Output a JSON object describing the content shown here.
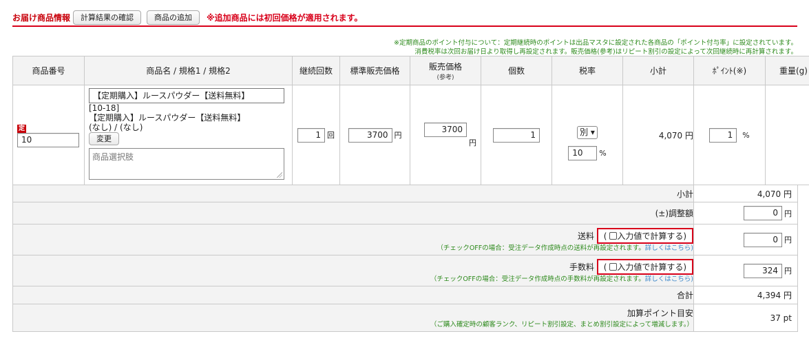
{
  "header": {
    "title": "お届け商品情報",
    "btn_confirm": "計算結果の確認",
    "btn_add": "商品の追加",
    "warning": "※追加商品には初回価格が適用されます。"
  },
  "notes": {
    "line1": "※定期商品のポイント付与について：定期継続時のポイントは出品マスタに設定された各商品の「ポイント付与率」に設定されています。",
    "line2": "消費税率は次回お届け日より取得し再設定されます。販売価格(参考)はリピート割引の設定によって次回継続時に再計算されます。"
  },
  "columns": {
    "code": "商品番号",
    "name": "商品名 / 規格1 / 規格2",
    "count": "継続回数",
    "std_price": "標準販売価格",
    "price": "販売価格",
    "price_sub": "(参考)",
    "qty": "個数",
    "tax": "税率",
    "subtotal": "小計",
    "point": "ﾎﾟｲﾝﾄ(※)",
    "weight": "重量(g)"
  },
  "item": {
    "badge": "定",
    "code": "10",
    "name_input": "【定期購入】ルースパウダー【送料無料】",
    "code_line": "[10-18]",
    "name_line": "【定期購入】ルースパウダー【送料無料】",
    "spec_line": "(なし) / (なし)",
    "change_btn": "変更",
    "option_placeholder": "商品選択肢",
    "count": "1",
    "count_unit": "回",
    "std_price": "3700",
    "yen": "円",
    "price": "3700",
    "qty": "1",
    "tax_select": "別",
    "tax_rate": "10",
    "percent": "%",
    "subtotal": "4,070 円",
    "point": "1",
    "weight": "-"
  },
  "summary": {
    "subtotal_label": "小計",
    "subtotal_value": "4,070 円",
    "adjust_label": "(±)調整額",
    "adjust_value": "0",
    "shipping_label": "送料",
    "shipping_check": "入力値で計算する)",
    "paren_open": "(",
    "shipping_note": "（チェックOFFの場合：受注データ作成時点の送料が再設定されます。",
    "detail_link": "詳しくはこちら)",
    "shipping_value": "0",
    "fee_label": "手数料",
    "fee_check": "入力値で計算する)",
    "fee_note": "（チェックOFFの場合：受注データ作成時点の手数料が再設定されます。",
    "fee_value": "324",
    "total_label": "合計",
    "total_value": "4,394 円",
    "points_label": "加算ポイント目安",
    "points_note": "（ご購入確定時の顧客ランク、リピート割引設定、まとめ割引設定によって増減します。）",
    "points_value": "37 pt",
    "yen": "円"
  }
}
